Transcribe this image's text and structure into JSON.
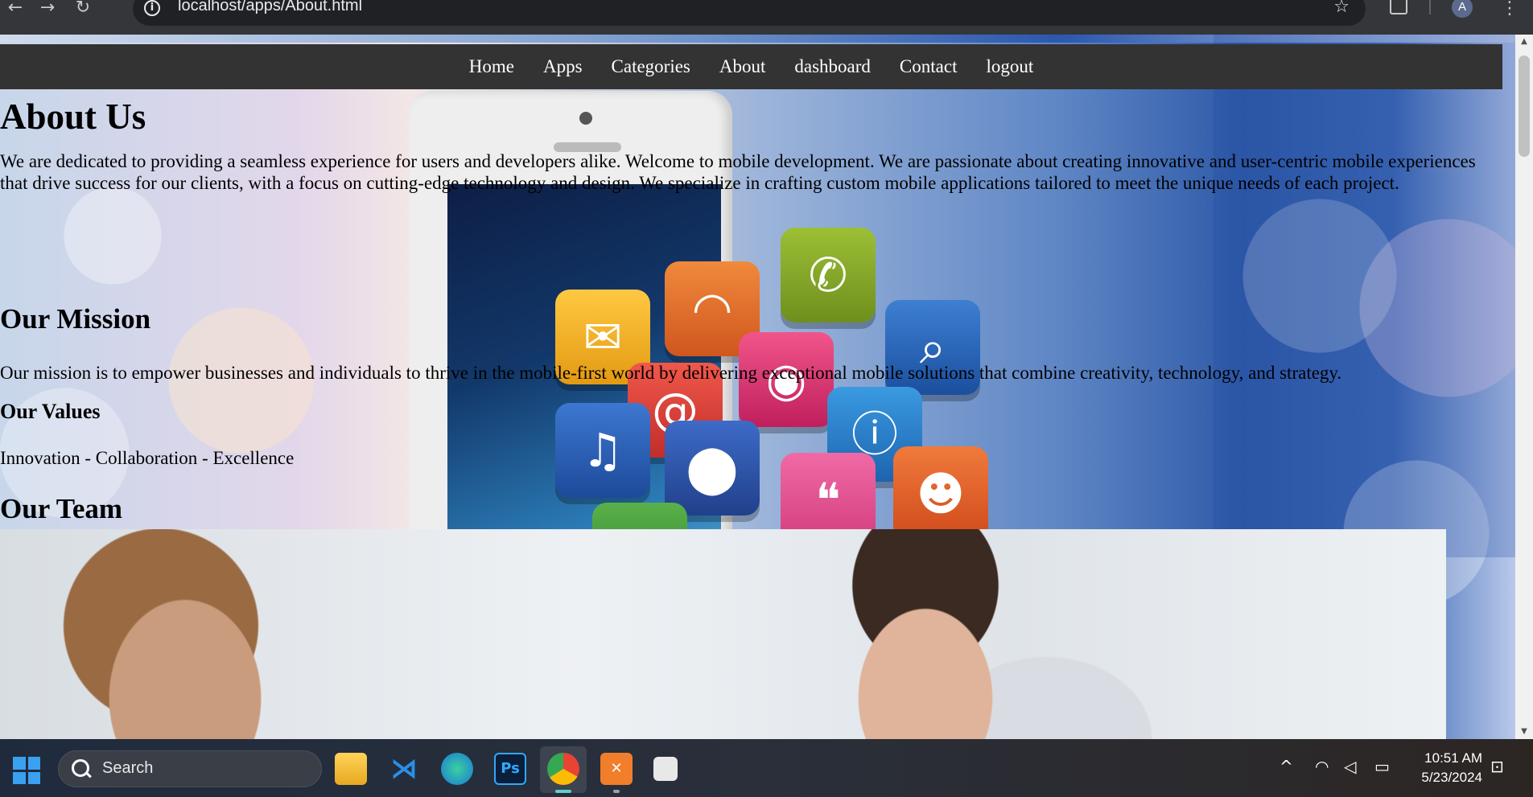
{
  "browser": {
    "url": "localhost/apps/About.html",
    "profile_initial": "A",
    "back": "←",
    "forward": "→",
    "reload": "↻",
    "info": "i",
    "star": "☆",
    "menu": "⋮"
  },
  "nav": {
    "items": [
      "Home",
      "Apps",
      "Categories",
      "About",
      "dashboard",
      "Contact",
      "logout"
    ]
  },
  "page": {
    "title": "About Us",
    "intro": "We are dedicated to providing a seamless experience for users and developers alike. Welcome to mobile development. We are passionate about creating innovative and user-centric mobile experiences that drive success for our clients, with a focus on cutting-edge technology and design. We specialize in crafting custom mobile applications tailored to meet the unique needs of each project.",
    "mission_heading": "Our Mission",
    "mission_text": "Our mission is to empower businesses and individuals to thrive in the mobile-first world by delivering exceptional mobile solutions that combine creativity, technology, and strategy.",
    "values_heading": "Our Values",
    "values_text": "Innovation - Collaboration - Excellence",
    "team_heading": "Our Team"
  },
  "taskbar": {
    "search_label": "Search",
    "time": "10:51 AM",
    "date": "5/23/2024",
    "ps_label": "Ps"
  },
  "colors": {
    "nav_bg": "#333333",
    "taskbar_accent": "#3aa0f0"
  }
}
